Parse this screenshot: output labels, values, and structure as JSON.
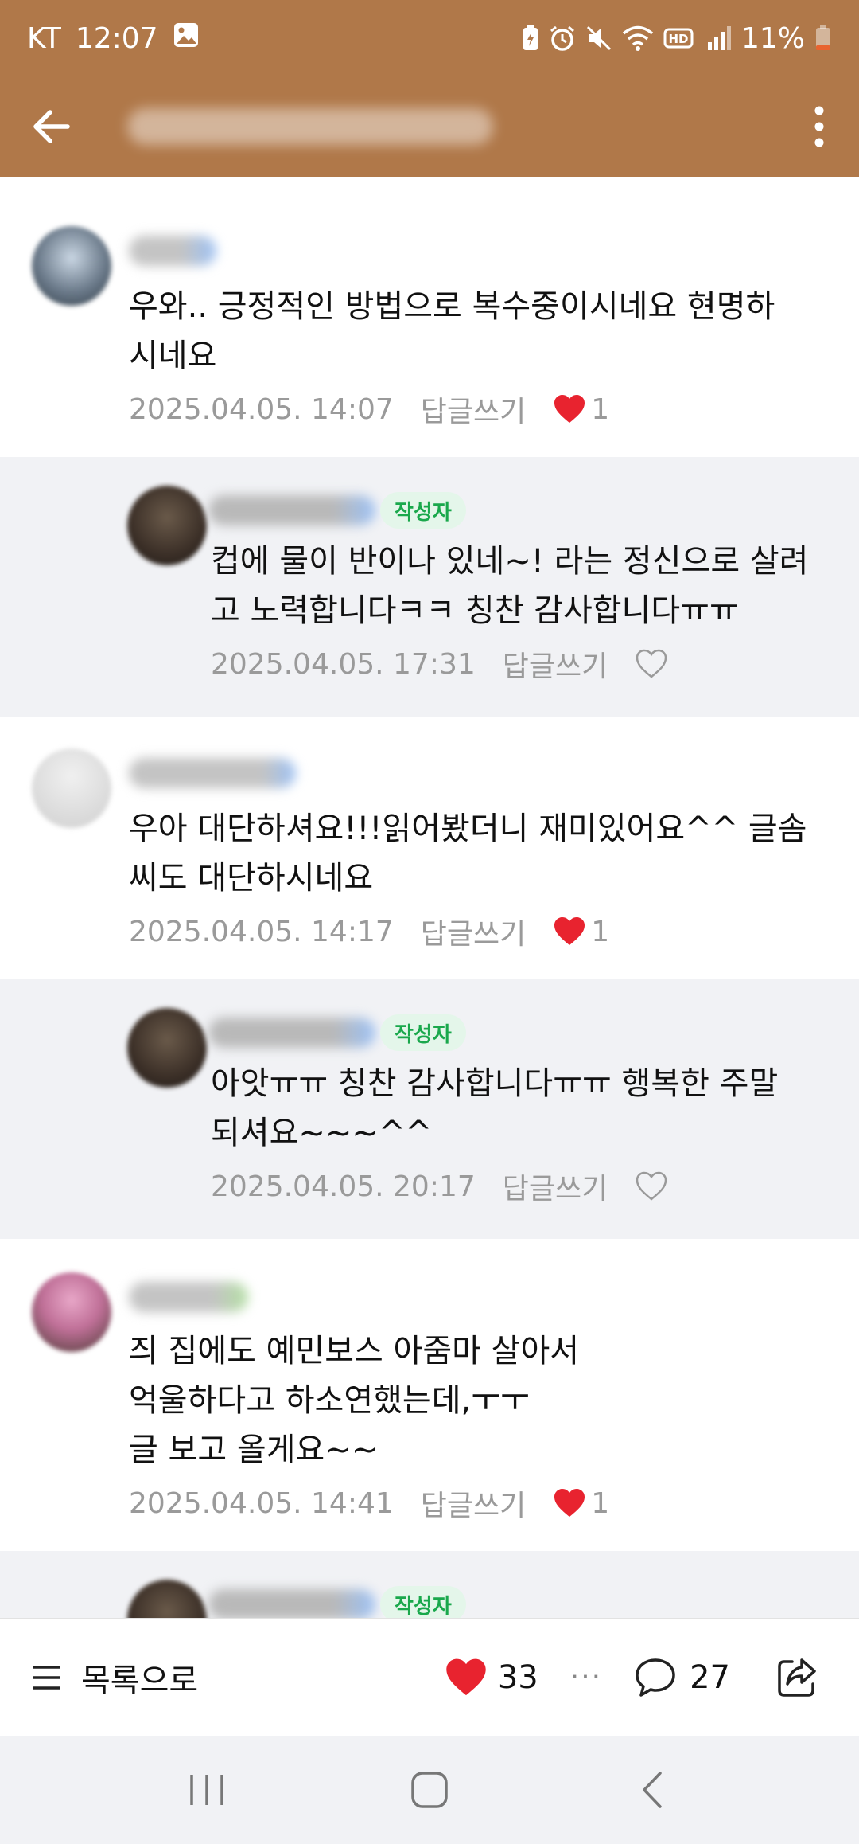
{
  "status_bar": {
    "carrier": "KT",
    "time": "12:07",
    "battery": "11%",
    "icons": [
      "image-icon",
      "battery-saver-icon",
      "alarm-icon",
      "mute-icon",
      "wifi-icon",
      "hd-icon",
      "signal-icon",
      "battery-icon"
    ]
  },
  "app_bar": {
    "back_icon": "arrow-left-icon",
    "more_icon": "more-vertical-icon"
  },
  "comments": [
    {
      "type": "comment",
      "text": "우와.. 긍정적인 방법으로 복수중이시네요 현명하\n시네요",
      "date": "2025.04.05. 14:07",
      "reply_label": "답글쓰기",
      "liked": true,
      "likes": "1"
    },
    {
      "type": "reply",
      "badge": "작성자",
      "text": "컵에 물이 반이나 있네~! 라는 정신으로 살려\n고 노력합니다ㅋㅋ 칭찬 감사합니다ㅠㅠ",
      "date": "2025.04.05. 17:31",
      "reply_label": "답글쓰기",
      "liked": false,
      "likes": ""
    },
    {
      "type": "comment",
      "text": "우아 대단하셔요!!!읽어봤더니 재미있어요^^ 글솜\n씨도 대단하시네요",
      "date": "2025.04.05. 14:17",
      "reply_label": "답글쓰기",
      "liked": true,
      "likes": "1"
    },
    {
      "type": "reply",
      "badge": "작성자",
      "text": "아앗ㅠㅠ 칭찬 감사합니다ㅠㅠ 행복한 주말\n되셔요~~~^^",
      "date": "2025.04.05. 20:17",
      "reply_label": "답글쓰기",
      "liked": false,
      "likes": ""
    },
    {
      "type": "comment",
      "text": "즤 집에도 예민보스 아줌마 살아서\n억울하다고 하소연했는데,ㅜㅜ\n글 보고 올게요~~",
      "date": "2025.04.05. 14:41",
      "reply_label": "답글쓰기",
      "liked": true,
      "likes": "1"
    },
    {
      "type": "reply",
      "badge": "작성자",
      "text": "",
      "date": "",
      "reply_label": "",
      "liked": false,
      "likes": ""
    }
  ],
  "bottom_bar": {
    "list_label": "목록으로",
    "like_count": "33",
    "more": "···",
    "comment_count": "27"
  },
  "colors": {
    "header_brown": "#b07849",
    "reply_bg": "#f1f2f5",
    "heart_red": "#e8232f",
    "badge_green": "#1aa84c",
    "meta_gray": "#9a9a9a"
  }
}
